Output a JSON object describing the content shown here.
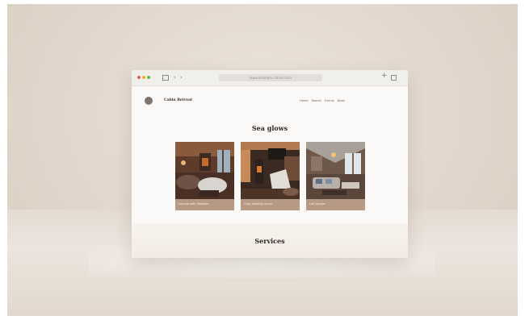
{
  "browser": {
    "url": "www.example-cabins.com"
  },
  "site": {
    "brand": "Cabin Retreat",
    "nav": [
      "Home",
      "Rooms",
      "Events",
      "Book"
    ]
  },
  "sections": {
    "featured_title": "Sea glows",
    "services_title": "Services"
  },
  "cards": [
    {
      "caption": "Lounge with fireplace"
    },
    {
      "caption": "Cozy reading corner"
    },
    {
      "caption": "Loft lounge"
    }
  ],
  "colors": {
    "backdrop": "#e3d9cf",
    "window_bg": "#faf9f7",
    "caption_bar": "#b79a86",
    "heading": "#2d2622"
  }
}
